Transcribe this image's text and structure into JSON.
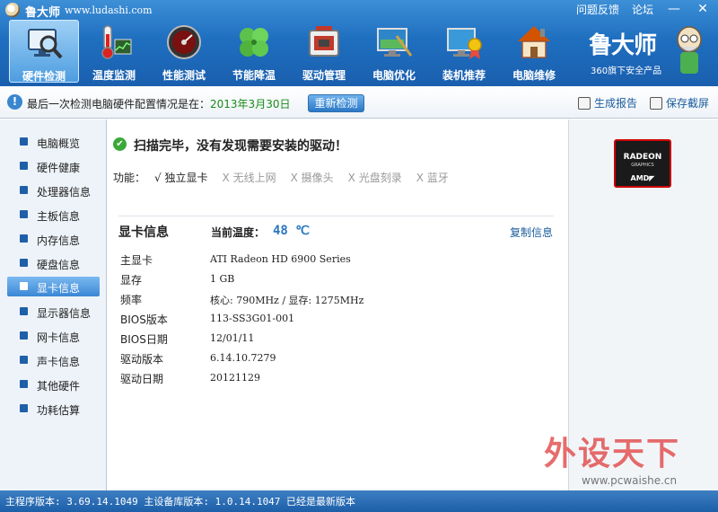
{
  "app": {
    "title": "鲁大师",
    "url": "www.ludashi.com",
    "links": [
      "问题反馈",
      "论坛"
    ],
    "window_buttons": {
      "minimize": "—",
      "close": "✕"
    }
  },
  "nav": {
    "items": [
      {
        "label": "硬件检测",
        "icon": "hardware-detect-icon",
        "active": true
      },
      {
        "label": "温度监测",
        "icon": "thermometer-icon"
      },
      {
        "label": "性能测试",
        "icon": "speedometer-icon"
      },
      {
        "label": "节能降温",
        "icon": "clover-leaf-icon"
      },
      {
        "label": "驱动管理",
        "icon": "driver-chip-icon"
      },
      {
        "label": "电脑优化",
        "icon": "optimize-monitor-icon"
      },
      {
        "label": "装机推荐",
        "icon": "award-monitor-icon"
      },
      {
        "label": "电脑维修",
        "icon": "house-repair-icon"
      }
    ]
  },
  "brand": {
    "name": "鲁大师",
    "subtitle": "360旗下安全产品"
  },
  "infobar": {
    "text_prefix": "最后一次检测电脑硬件配置情况是在：",
    "date": "2013年3月30日",
    "recheck_button": "重新检测",
    "report_link": "生成报告",
    "save_link": "保存截屏"
  },
  "sidebar": {
    "items": [
      {
        "label": "电脑概览"
      },
      {
        "label": "硬件健康"
      },
      {
        "label": "处理器信息"
      },
      {
        "label": "主板信息"
      },
      {
        "label": "内存信息"
      },
      {
        "label": "硬盘信息"
      },
      {
        "label": "显卡信息",
        "active": true
      },
      {
        "label": "显示器信息"
      },
      {
        "label": "网卡信息"
      },
      {
        "label": "声卡信息"
      },
      {
        "label": "其他硬件"
      },
      {
        "label": "功耗估算"
      }
    ]
  },
  "main": {
    "scan_result": "扫描完毕，没有发现需要安装的驱动！",
    "features_label": "功能：",
    "features": [
      {
        "mark": "√",
        "label": "独立显卡",
        "enabled": true
      },
      {
        "mark": "X",
        "label": "无线上网",
        "enabled": false
      },
      {
        "mark": "X",
        "label": "摄像头",
        "enabled": false
      },
      {
        "mark": "X",
        "label": "光盘刻录",
        "enabled": false
      },
      {
        "mark": "X",
        "label": "蓝牙",
        "enabled": false
      }
    ],
    "section_title": "显卡信息",
    "temp_label": "当前温度：",
    "temp_value": "48 ℃",
    "copy_link": "复制信息",
    "specs": [
      {
        "key": "主显卡",
        "value": "ATI Radeon HD 6900 Series"
      },
      {
        "key": "显存",
        "value": "1 GB"
      },
      {
        "key": "频率",
        "value": "核心: 790MHz / 显存: 1275MHz"
      },
      {
        "key": "BIOS版本",
        "value": "113-SS3G01-001"
      },
      {
        "key": "BIOS日期",
        "value": "12/01/11"
      },
      {
        "key": "驱动版本",
        "value": "6.14.10.7279"
      },
      {
        "key": "驱动日期",
        "value": "20121129"
      }
    ]
  },
  "right_panel": {
    "logo": {
      "line1": "RADEON",
      "line2": "GRAPHICS",
      "line3": "AMD◤"
    }
  },
  "watermark": {
    "text": "外设天下",
    "url": "www.pcwaishe.cn"
  },
  "status": {
    "text": "主程序版本: 3.69.14.1049  主设备库版本: 1.0.14.1047  已经是最新版本"
  },
  "colors": {
    "header_blue": "#1f6fc0",
    "status_blue": "#1d5fa8",
    "accent_green": "#1a8a1a",
    "temperature": "#2a78c0"
  }
}
